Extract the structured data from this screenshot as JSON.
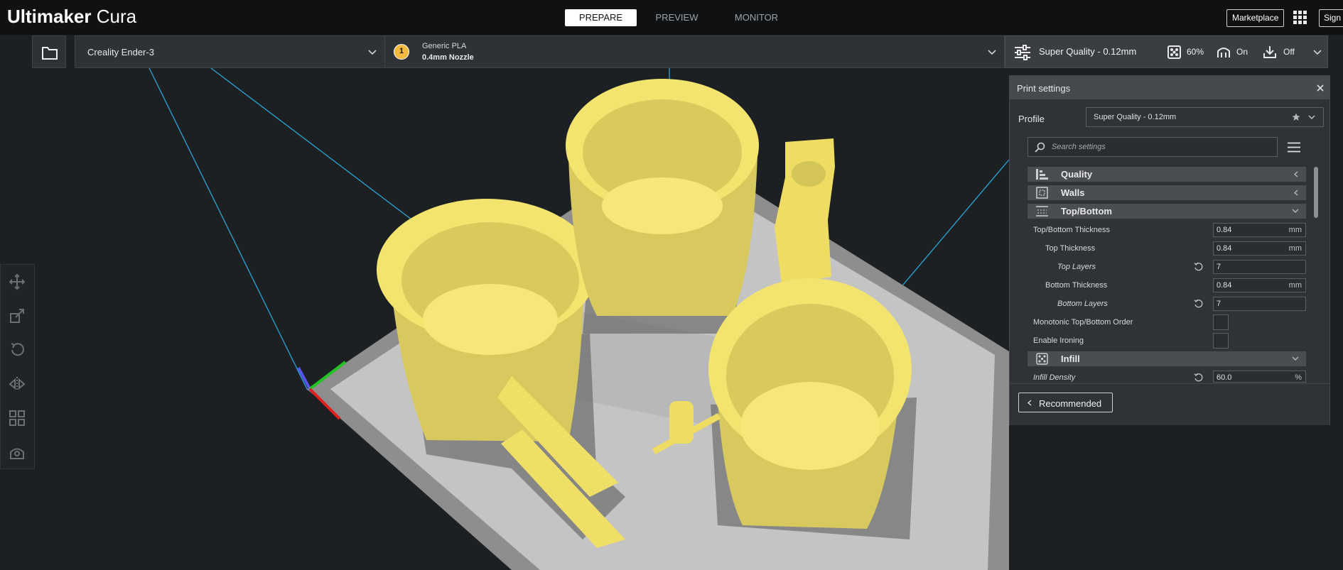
{
  "app": {
    "title_bold": "Ultimaker",
    "title_light": "Cura"
  },
  "stages": [
    "PREPARE",
    "PREVIEW",
    "MONITOR"
  ],
  "header": {
    "marketplace": "Marketplace",
    "signin": "Sign in"
  },
  "printer": {
    "name": "Creality Ender-3"
  },
  "extruder": {
    "number": "1",
    "material": "Generic PLA",
    "nozzle": "0.4mm Nozzle"
  },
  "quality_bar": {
    "profile": "Super Quality - 0.12mm",
    "infill": "60%",
    "support": "On",
    "adhesion": "Off"
  },
  "panel": {
    "title": "Print settings",
    "profile_label": "Profile",
    "profile_value": "Super Quality - 0.12mm",
    "search_placeholder": "Search settings",
    "categories": {
      "quality": "Quality",
      "walls": "Walls",
      "topbottom": "Top/Bottom",
      "infill": "Infill"
    },
    "settings": [
      {
        "label": "Top/Bottom Thickness",
        "value": "0.84",
        "unit": "mm"
      },
      {
        "label": "Top Thickness",
        "value": "0.84",
        "unit": "mm"
      },
      {
        "label": "Top Layers",
        "value": "7",
        "unit": ""
      },
      {
        "label": "Bottom Thickness",
        "value": "0.84",
        "unit": "mm"
      },
      {
        "label": "Bottom Layers",
        "value": "7",
        "unit": ""
      },
      {
        "label": "Monotonic Top/Bottom Order"
      },
      {
        "label": "Enable Ironing"
      },
      {
        "label": "Infill Density",
        "value": "60.0",
        "unit": "%"
      }
    ],
    "recommended": "Recommended"
  },
  "colors": {
    "model": "#f3e46f",
    "plate": "#bdbdbd",
    "accent": "#f3ba3e",
    "background": "#1d2023"
  },
  "icons": {
    "open": "folder-icon",
    "apps": "grid-icon",
    "quality": "sliders-icon",
    "infill": "infill-icon",
    "support": "support-icon",
    "adhesion": "adhesion-icon",
    "close": "close-icon",
    "star": "star-icon",
    "search": "search-icon",
    "menu": "hamburger-icon",
    "reset": "reset-icon",
    "tools": [
      "move-icon",
      "scale-icon",
      "rotate-icon",
      "mirror-icon",
      "per-model-settings-icon",
      "support-blocker-icon"
    ]
  }
}
